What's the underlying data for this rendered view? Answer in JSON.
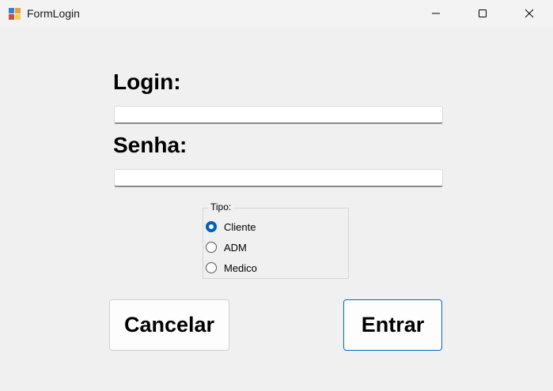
{
  "window": {
    "title": "FormLogin",
    "icon": "winforms-app-icon",
    "controls": [
      "minimize-icon",
      "maximize-icon",
      "close-icon"
    ]
  },
  "form": {
    "login_label": "Login:",
    "login_value": "",
    "senha_label": "Senha:",
    "senha_value": ""
  },
  "tipo": {
    "legend": "Tipo:",
    "options": [
      {
        "label": "Cliente",
        "checked": true
      },
      {
        "label": "ADM",
        "checked": false
      },
      {
        "label": "Medico",
        "checked": false
      }
    ]
  },
  "buttons": {
    "cancel_label": "Cancelar",
    "enter_label": "Entrar"
  },
  "colors": {
    "accent": "#005fb8",
    "background": "#f0f0f0"
  }
}
